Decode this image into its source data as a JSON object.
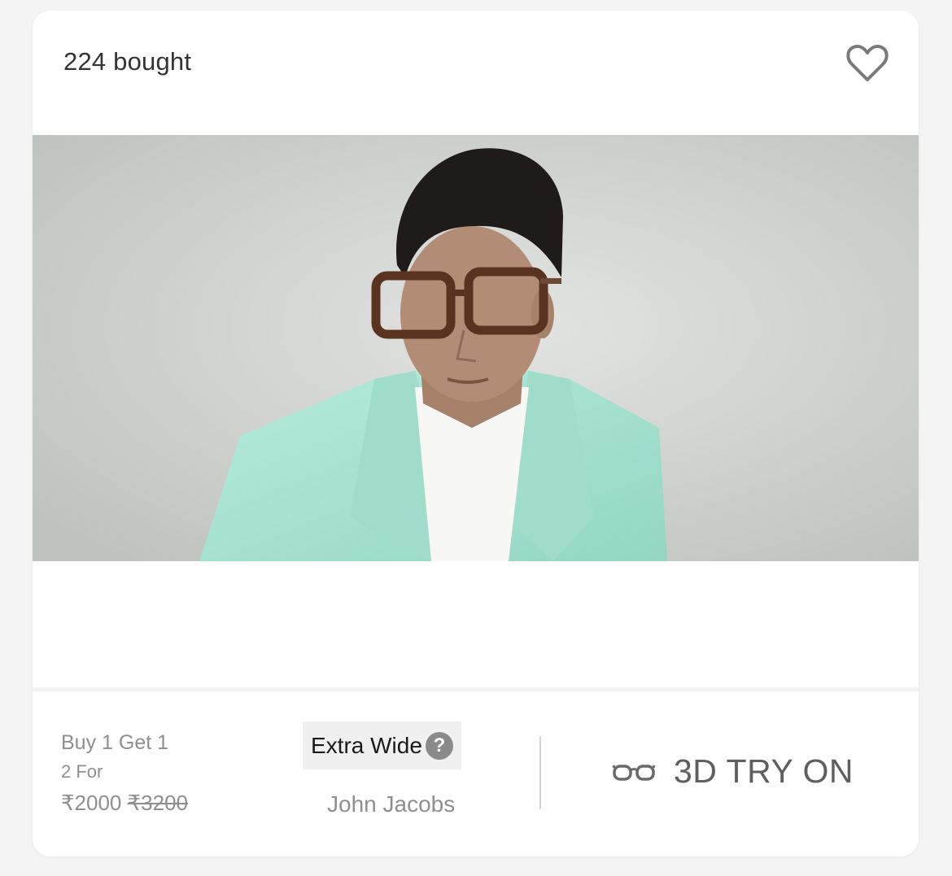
{
  "card": {
    "bought_label": "224 bought",
    "wishlist_icon": "heart-outline-icon"
  },
  "image": {
    "description_icon": "product-model-photo",
    "colors": {
      "background": "#c9ccc9",
      "jacket": "#a9e3d2",
      "shirt": "#ffffff",
      "hair": "#1e1a17",
      "skin": "#b08a73",
      "frames": "#5a3320"
    }
  },
  "footer": {
    "offer_line1": "Buy 1 Get 1",
    "offer_line2": "2 For",
    "price_current": "₹2000",
    "price_original": "₹3200",
    "badge_label": "Extra Wide",
    "help_symbol": "?",
    "brand": "John Jacobs",
    "tryon_label": "3D TRY ON",
    "tryon_icon": "glasses-icon"
  }
}
